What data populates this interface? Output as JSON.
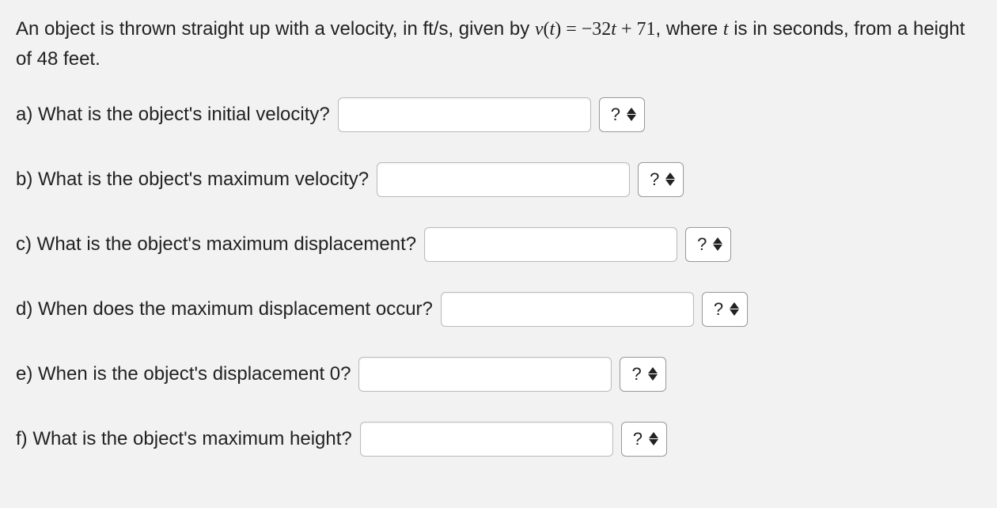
{
  "statement": {
    "prefix": "An object is thrown straight up with a velocity, in ft/s, given by ",
    "func": "v",
    "openParen": "(",
    "var": "t",
    "closeParenEq": ") = ",
    "minus": "−",
    "coef": "32",
    "var2": "t",
    "plus": " + 71",
    "mid": ", where ",
    "var3": "t",
    "suffix": " is in seconds, from a height of 48 feet."
  },
  "questions": {
    "a": {
      "label": "a) What is the object's initial velocity?",
      "select": "?"
    },
    "b": {
      "label": "b) What is the object's maximum velocity?",
      "select": "?"
    },
    "c": {
      "label": "c) What is the object's maximum displacement?",
      "select": "?"
    },
    "d": {
      "label": "d) When does the maximum displacement occur?",
      "select": "?"
    },
    "e": {
      "label": "e) When is the object's displacement 0?",
      "select": "?"
    },
    "f": {
      "label": "f) What is the object's maximum height?",
      "select": "?"
    }
  }
}
